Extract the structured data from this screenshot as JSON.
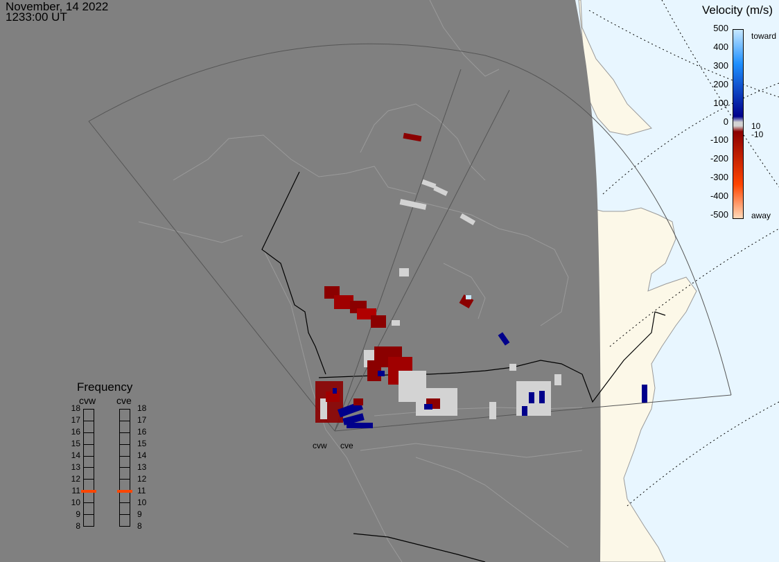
{
  "header": {
    "date": "November, 14 2022",
    "time": "1233:00 UT"
  },
  "colorbar": {
    "title": "Velocity (m/s)",
    "ticks": [
      "500",
      "400",
      "300",
      "200",
      "100",
      "0",
      "-100",
      "-200",
      "-300",
      "-400",
      "-500"
    ],
    "threshold_pos": "10",
    "threshold_neg": "-10",
    "toward_label": "toward",
    "away_label": "away",
    "colors": {
      "toward_light": "#c6e8ff",
      "toward_mid": "#1e90ff",
      "toward_dark": "#00008b",
      "ground_scatter": "#d3d3d3",
      "away_dark": "#8b0000",
      "away_mid": "#ff4500",
      "away_light": "#ffdab9"
    }
  },
  "frequency": {
    "title": "Frequency",
    "radars": [
      "cvw",
      "cve"
    ],
    "ticks": [
      "18",
      "17",
      "16",
      "15",
      "14",
      "13",
      "12",
      "11",
      "10",
      "9",
      "8"
    ],
    "cvw_mhz": 11,
    "cve_mhz": 11,
    "marker_color": "#ff4500"
  },
  "sites": {
    "west": "cvw",
    "east": "cve"
  },
  "colors": {
    "night": "#808080",
    "land_day": "#fcf8e8",
    "ocean_day": "#e8f6ff",
    "coast": "#9a9a9a",
    "border": "#000000",
    "fov": "#555555"
  }
}
